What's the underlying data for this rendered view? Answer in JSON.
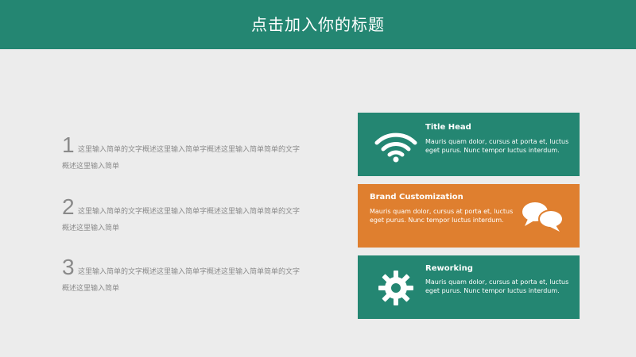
{
  "header": {
    "title": "点击加入你的标题"
  },
  "items": [
    {
      "number": "1",
      "line1": "这里输入简单的文字概述这里输入简单字概述这里输入简单简单的文字",
      "line2": "概述这里输入简单"
    },
    {
      "number": "2",
      "line1": "这里输入简单的文字概述这里输入简单字概述这里输入简单简单的文字",
      "line2": "概述这里输入简单"
    },
    {
      "number": "3",
      "line1": "这里输入简单的文字概述这里输入简单字概述这里输入简单简单的文字",
      "line2": "概述这里输入简单"
    }
  ],
  "cards": [
    {
      "title": "Title Head",
      "desc": "Mauris quam dolor, cursus at porta et, luctus eget purus. Nunc tempor luctus interdum.",
      "icon": "wifi-icon",
      "color": "#248672"
    },
    {
      "title": "Brand Customization",
      "desc": "Mauris quam dolor, cursus at porta et, luctus eget purus. Nunc tempor luctus interdum.",
      "icon": "chat-bubbles-icon",
      "color": "#df7f2f"
    },
    {
      "title": "Reworking",
      "desc": "Mauris quam dolor, cursus at porta et, luctus eget purus. Nunc tempor luctus interdum.",
      "icon": "gear-icon",
      "color": "#248672"
    }
  ],
  "colors": {
    "teal": "#248672",
    "orange": "#df7f2f",
    "background": "#ececec",
    "text_gray": "#8b8b8b"
  }
}
